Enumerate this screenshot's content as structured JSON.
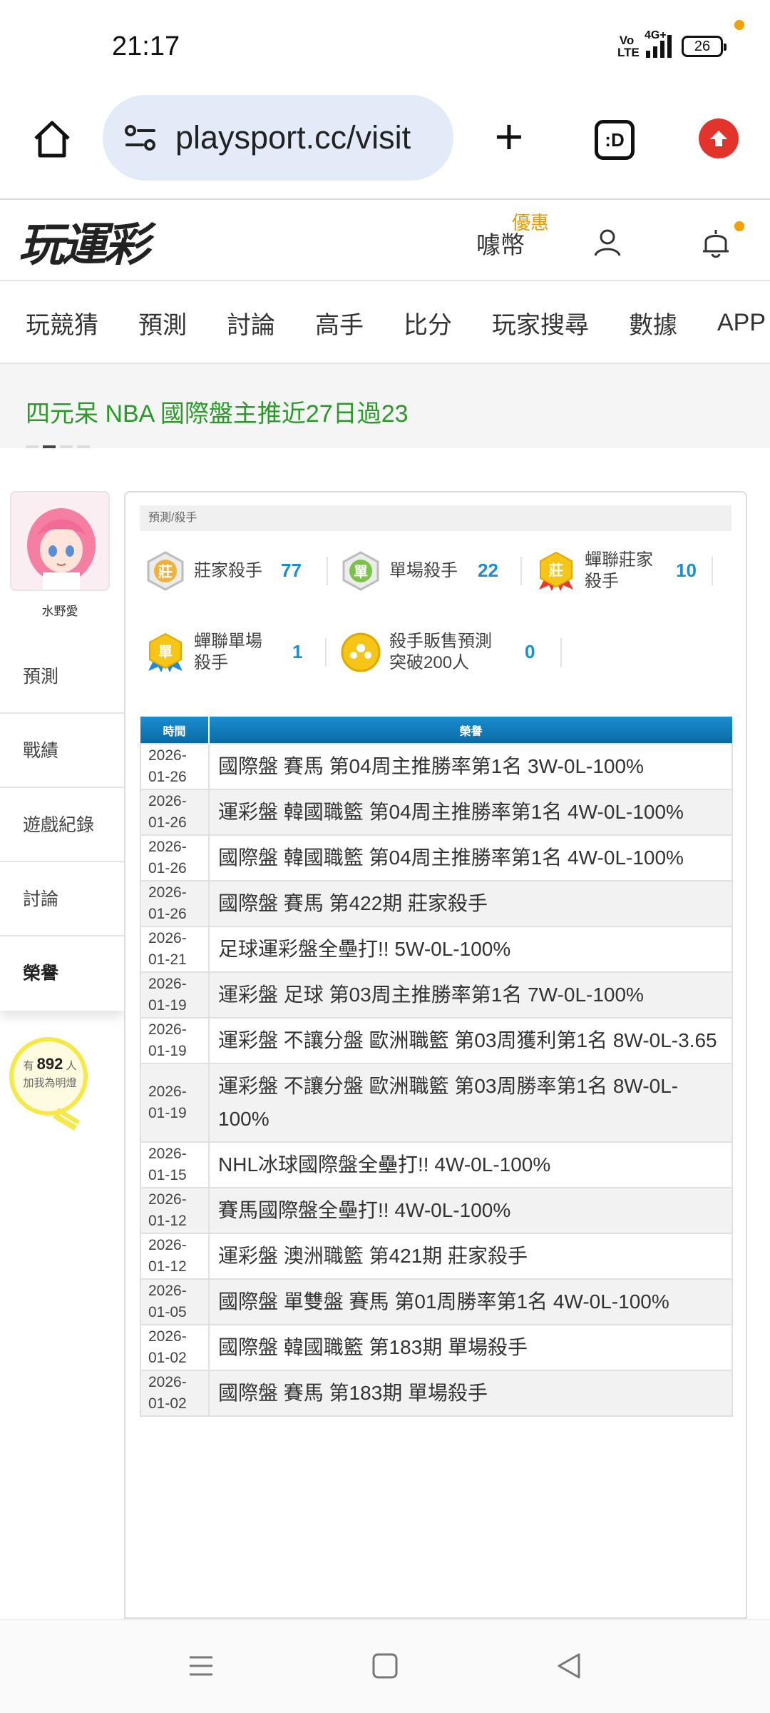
{
  "status_bar": {
    "time": "21:17",
    "volte": "Vo LTE",
    "network": "4G+",
    "battery": "26"
  },
  "browser": {
    "url": "playsport.cc/visit",
    "tabs_label": ":D",
    "icons": [
      "home-icon",
      "site-settings-icon",
      "new-tab-icon",
      "tab-switcher-icon",
      "upgrade-icon"
    ]
  },
  "header": {
    "logo": "玩運彩",
    "promo_tag": "優惠",
    "coin_label": "噱幣",
    "icons": [
      "user-icon",
      "bell-icon"
    ]
  },
  "nav": {
    "items": [
      "玩競猜",
      "預測",
      "討論",
      "高手",
      "比分",
      "玩家搜尋",
      "數據",
      "APP"
    ]
  },
  "ticker": {
    "text": "四元呆 NBA 國際盤主推近27日過23"
  },
  "profile": {
    "username": "水野愛",
    "menu": [
      "預測",
      "戰績",
      "遊戲紀錄",
      "討論",
      "榮譽"
    ],
    "active_menu": "榮譽",
    "fans_prefix": "有",
    "fans_count": "892",
    "fans_suffix": "人",
    "fans_cta": "加我為明燈"
  },
  "panel": {
    "breadcrumb": "預測/殺手",
    "badges": [
      {
        "name": "莊家殺手",
        "count": "77",
        "medal_char": "莊",
        "medal_color": "#c9c9c9"
      },
      {
        "name": "單場殺手",
        "count": "22",
        "medal_char": "單",
        "medal_color": "#7dc24a"
      },
      {
        "name": "蟬聯莊家",
        "name2": "殺手",
        "count": "10",
        "medal_char": "莊",
        "medal_color": "#f5c518"
      },
      {
        "name": "蟬聯單場",
        "name2": "殺手",
        "count": "1",
        "medal_char": "單",
        "medal_color": "#f5c518"
      },
      {
        "name": "殺手販售預測",
        "name2": "突破200人",
        "count": "0",
        "medal_char": "",
        "medal_color": "#f5c518"
      }
    ],
    "table": {
      "headers": [
        "時間",
        "榮譽"
      ],
      "rows": [
        {
          "date1": "2026-",
          "date2": "01-26",
          "desc": "國際盤 賽馬 第04周主推勝率第1名 3W-0L-100%"
        },
        {
          "date1": "2026-",
          "date2": "01-26",
          "desc": "運彩盤 韓國職籃 第04周主推勝率第1名 4W-0L-100%"
        },
        {
          "date1": "2026-",
          "date2": "01-26",
          "desc": "國際盤 韓國職籃 第04周主推勝率第1名 4W-0L-100%"
        },
        {
          "date1": "2026-",
          "date2": "01-26",
          "desc": "國際盤 賽馬 第422期 莊家殺手"
        },
        {
          "date1": "2026-",
          "date2": "01-21",
          "desc": "足球運彩盤全壘打!! 5W-0L-100%"
        },
        {
          "date1": "2026-",
          "date2": "01-19",
          "desc": "運彩盤 足球 第03周主推勝率第1名 7W-0L-100%"
        },
        {
          "date1": "2026-",
          "date2": "01-19",
          "desc": "運彩盤 不讓分盤 歐洲職籃 第03周獲利第1名 8W-0L-3.65"
        },
        {
          "date1": "2026-",
          "date2": "01-19",
          "desc": "運彩盤 不讓分盤 歐洲職籃 第03周勝率第1名 8W-0L-100%"
        },
        {
          "date1": "2026-",
          "date2": "01-15",
          "desc": "NHL冰球國際盤全壘打!! 4W-0L-100%"
        },
        {
          "date1": "2026-",
          "date2": "01-12",
          "desc": "賽馬國際盤全壘打!! 4W-0L-100%"
        },
        {
          "date1": "2026-",
          "date2": "01-12",
          "desc": "運彩盤 澳洲職籃 第421期 莊家殺手"
        },
        {
          "date1": "2026-",
          "date2": "01-05",
          "desc": "國際盤 單雙盤 賽馬 第01周勝率第1名 4W-0L-100%"
        },
        {
          "date1": "2026-",
          "date2": "01-02",
          "desc": "國際盤 韓國職籃 第183期 單場殺手"
        },
        {
          "date1": "2026-",
          "date2": "01-02",
          "desc": "國際盤 賽馬 第183期 單場殺手"
        }
      ]
    }
  },
  "colors": {
    "accent_blue": "#1a8fd0",
    "headline_green": "#2b9a2b",
    "promo_orange": "#e89a00",
    "upgrade_red": "#e2342b"
  },
  "system_nav": [
    "menu-icon",
    "home-square-icon",
    "back-icon"
  ]
}
